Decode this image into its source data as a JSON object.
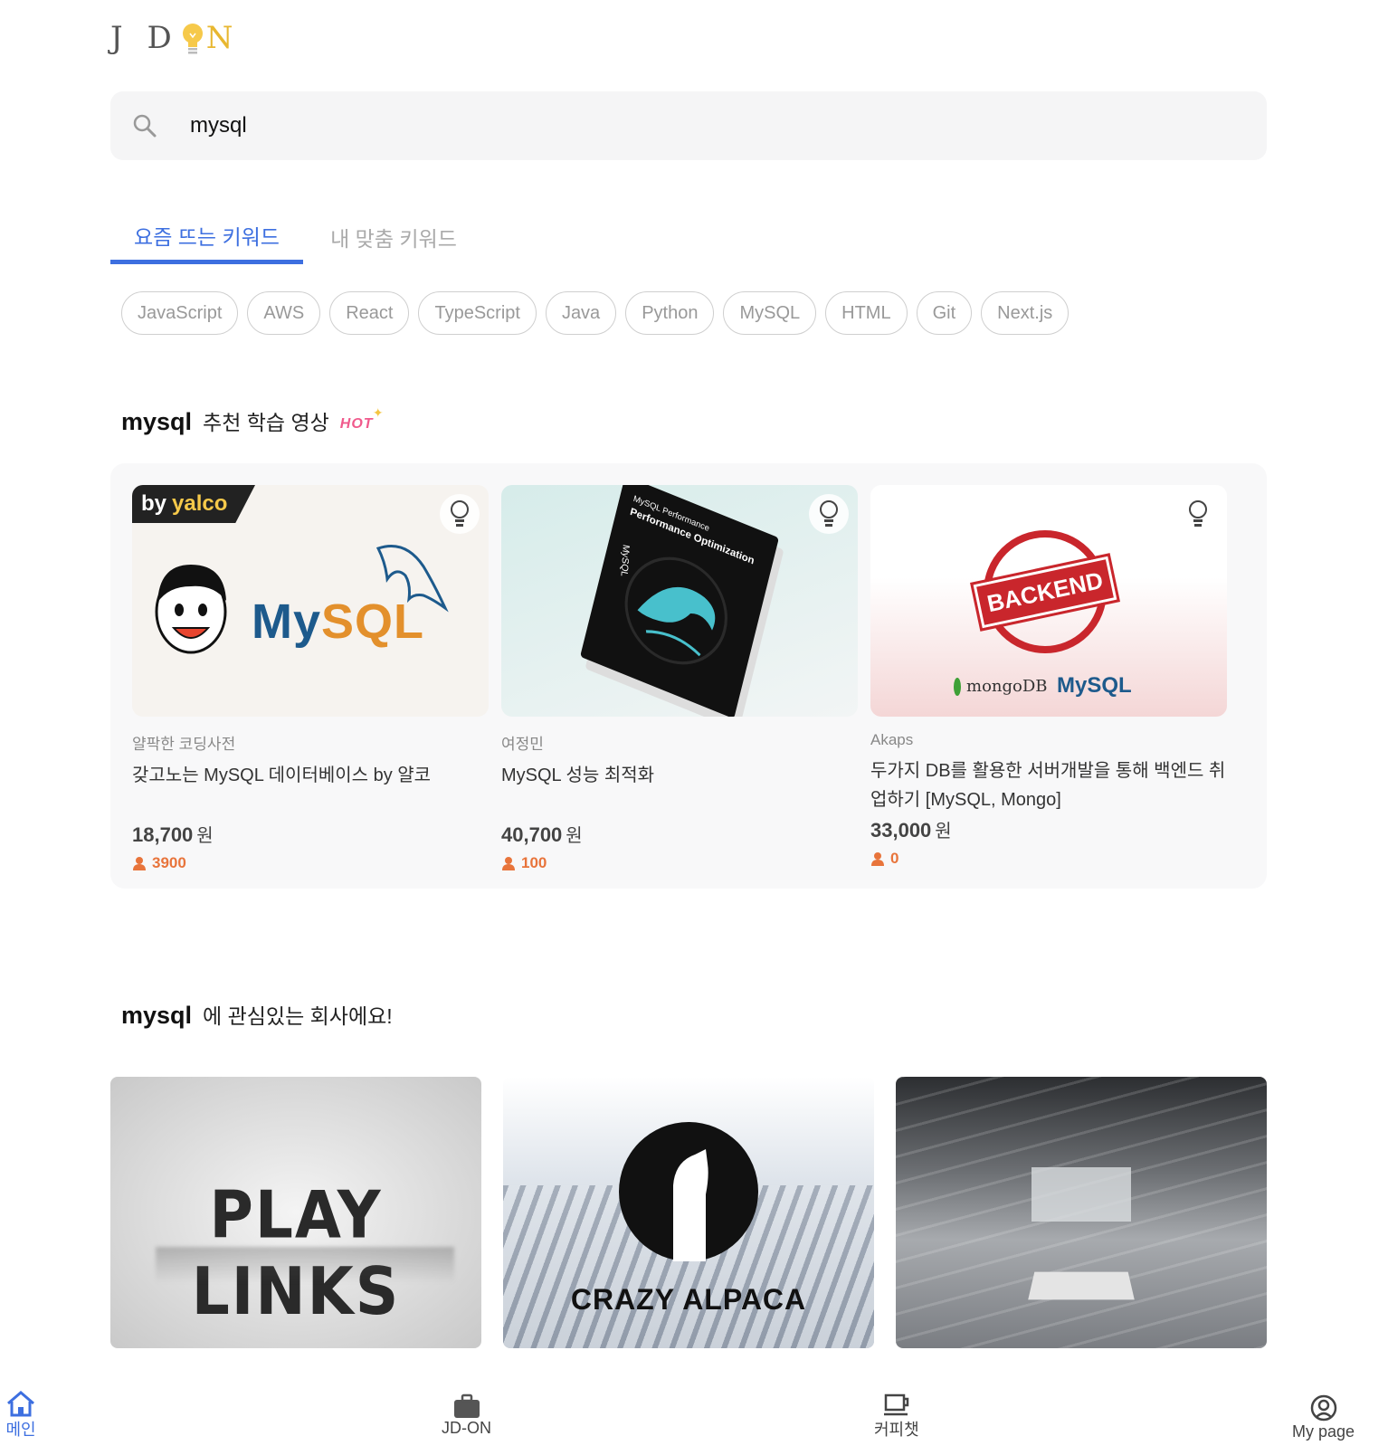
{
  "logo": {
    "text_left": "J D",
    "text_right": "N"
  },
  "search": {
    "value": "mysql",
    "placeholder": ""
  },
  "tabs": [
    {
      "label": "요즘 뜨는 키워드",
      "active": true
    },
    {
      "label": "내 맞춤 키워드",
      "active": false
    }
  ],
  "keywords": [
    "JavaScript",
    "AWS",
    "React",
    "TypeScript",
    "Java",
    "Python",
    "MySQL",
    "HTML",
    "Git",
    "Next.js"
  ],
  "courses_section": {
    "keyword": "mysql",
    "title": "추천 학습 영상",
    "badge": "HOT"
  },
  "courses": [
    {
      "teacher": "얄팍한 코딩사전",
      "title": "갖고노는 MySQL 데이터베이스 by 얄코",
      "price": "18,700",
      "currency": "원",
      "students": "3900",
      "ribbon_by": "by",
      "ribbon_name": "yalco",
      "thumb_text": "MySQL"
    },
    {
      "teacher": "여정민",
      "title": "MySQL 성능 최적화",
      "price": "40,700",
      "currency": "원",
      "students": "100",
      "book_title": "Performance Optimization",
      "book_top": "MySQL Performance",
      "book_side": "MySQL"
    },
    {
      "teacher": "Akaps",
      "title": "두가지 DB를 활용한 서버개발을 통해 백엔드 취업하기 [MySQL, Mongo]",
      "price": "33,000",
      "currency": "원",
      "students": "0",
      "stamp": "BACKEND",
      "logo1": "mongoDB",
      "logo2": "MySQL"
    }
  ],
  "companies_section": {
    "keyword": "mysql",
    "title": "에 관심있는 회사에요!"
  },
  "companies": [
    {
      "name": "PLAY LINKS"
    },
    {
      "name": "CRAZY ALPACA"
    },
    {
      "name": ""
    }
  ],
  "nav": [
    {
      "label": "메인",
      "icon": "home-icon",
      "active": true
    },
    {
      "label": "JD-ON",
      "icon": "briefcase-icon",
      "active": false
    },
    {
      "label": "커피챗",
      "icon": "coffee-icon",
      "active": false
    },
    {
      "label": "My page",
      "icon": "user-circle-icon",
      "active": false
    }
  ],
  "colors": {
    "accent": "#3d6fe0",
    "student": "#e8743b",
    "hot": "#f05a8c"
  }
}
